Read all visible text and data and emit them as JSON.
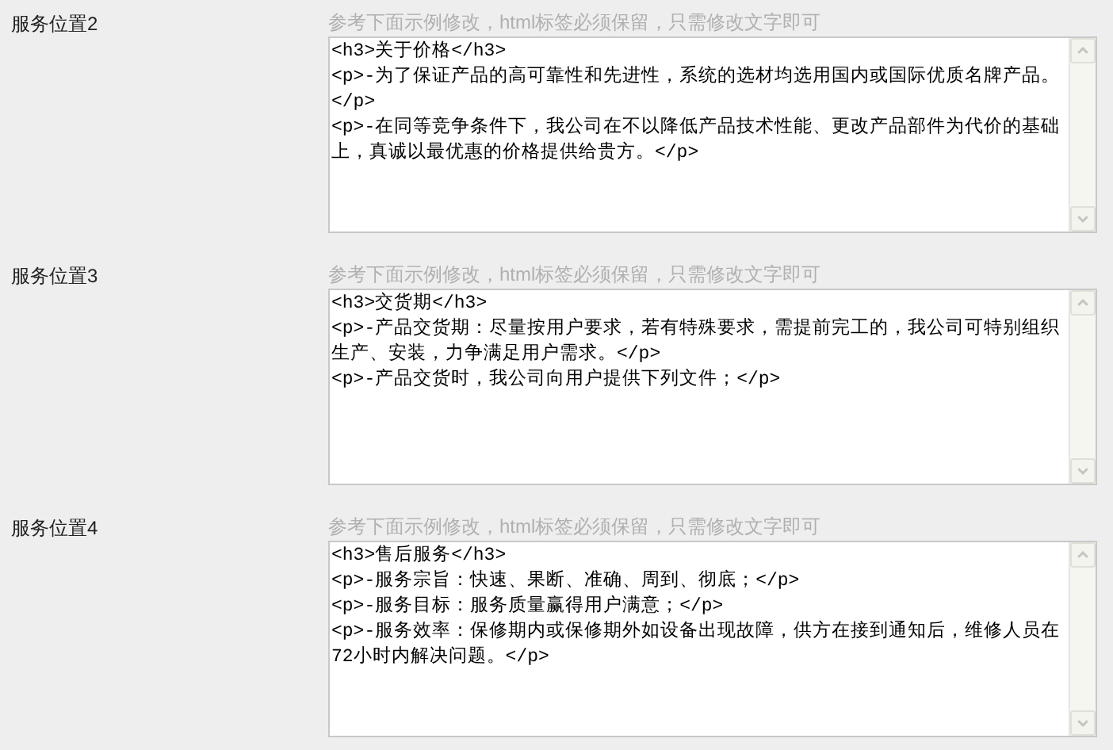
{
  "sections": [
    {
      "label": "服务位置2",
      "hint": "参考下面示例修改，html标签必须保留，只需修改文字即可",
      "value": "<h3>关于价格</h3>\n<p>-为了保证产品的高可靠性和先进性，系统的选材均选用国内或国际优质名牌产品。</p>\n<p>-在同等竞争条件下，我公司在不以降低产品技术性能、更改产品部件为代价的基础上，真诚以最优惠的价格提供给贵方。</p>"
    },
    {
      "label": "服务位置3",
      "hint": "参考下面示例修改，html标签必须保留，只需修改文字即可",
      "value": "<h3>交货期</h3>\n<p>-产品交货期：尽量按用户要求，若有特殊要求，需提前完工的，我公司可特别组织生产、安装，力争满足用户需求。</p>\n<p>-产品交货时，我公司向用户提供下列文件；</p>"
    },
    {
      "label": "服务位置4",
      "hint": "参考下面示例修改，html标签必须保留，只需修改文字即可",
      "value": "<h3>售后服务</h3>\n<p>-服务宗旨：快速、果断、准确、周到、彻底；</p>\n<p>-服务目标：服务质量赢得用户满意；</p>\n<p>-服务效率：保修期内或保修期外如设备出现故障，供方在接到通知后，维修人员在72小时内解决问题。</p>"
    }
  ]
}
